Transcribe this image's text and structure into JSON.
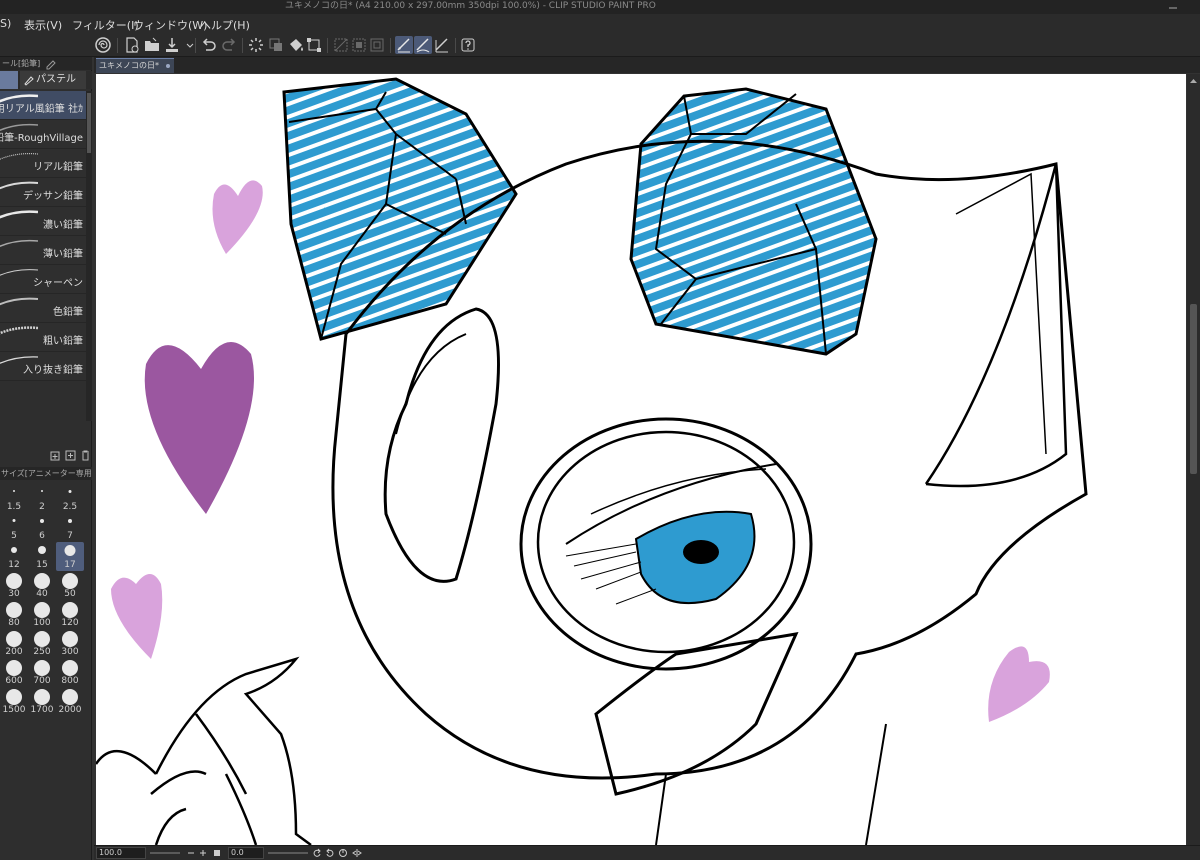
{
  "window": {
    "title": "ユキメノコの日* (A4 210.00 x 297.00mm 350dpi 100.0%)  - CLIP STUDIO PAINT PRO"
  },
  "menubar": {
    "items": [
      "S)",
      "表示(V)",
      "フィルター(I)",
      "ウィンドウ(W)",
      "ヘルプ(H)"
    ]
  },
  "subtool_panel": {
    "tab_label": "ール[鉛筆]",
    "group_tab_label": "パステル",
    "brushes": [
      {
        "label": "用リアル風鉛筆 社ｶ",
        "selected": true
      },
      {
        "label": "鉛筆-RoughVillage",
        "selected": false
      },
      {
        "label": "リアル鉛筆",
        "selected": false
      },
      {
        "label": "デッサン鉛筆",
        "selected": false
      },
      {
        "label": "濃い鉛筆",
        "selected": false
      },
      {
        "label": "薄い鉛筆",
        "selected": false
      },
      {
        "label": "シャーペン",
        "selected": false
      },
      {
        "label": "色鉛筆",
        "selected": false
      },
      {
        "label": "粗い鉛筆",
        "selected": false
      },
      {
        "label": "入り抜き鉛筆",
        "selected": false
      }
    ]
  },
  "brush_size_panel": {
    "header": "サイズ[アニメーター専用リアル",
    "sizes": [
      "1.5",
      "2",
      "2.5",
      "5",
      "6",
      "7",
      "12",
      "15",
      "17",
      "30",
      "40",
      "50",
      "80",
      "100",
      "120",
      "200",
      "250",
      "300",
      "600",
      "700",
      "800",
      "1500",
      "1700",
      "2000"
    ],
    "selected": "17"
  },
  "document_tab": {
    "label": "ユキメノコの日*"
  },
  "statusbar": {
    "zoom": "100.0",
    "rotation": "0.0"
  },
  "colors": {
    "ui_dark": "#2b2b2b",
    "selection": "#4f5d7c",
    "ice_blue": "#2e9bd0",
    "heart_pink": "#d9a3dc",
    "heart_purple": "#8a3a8f"
  }
}
